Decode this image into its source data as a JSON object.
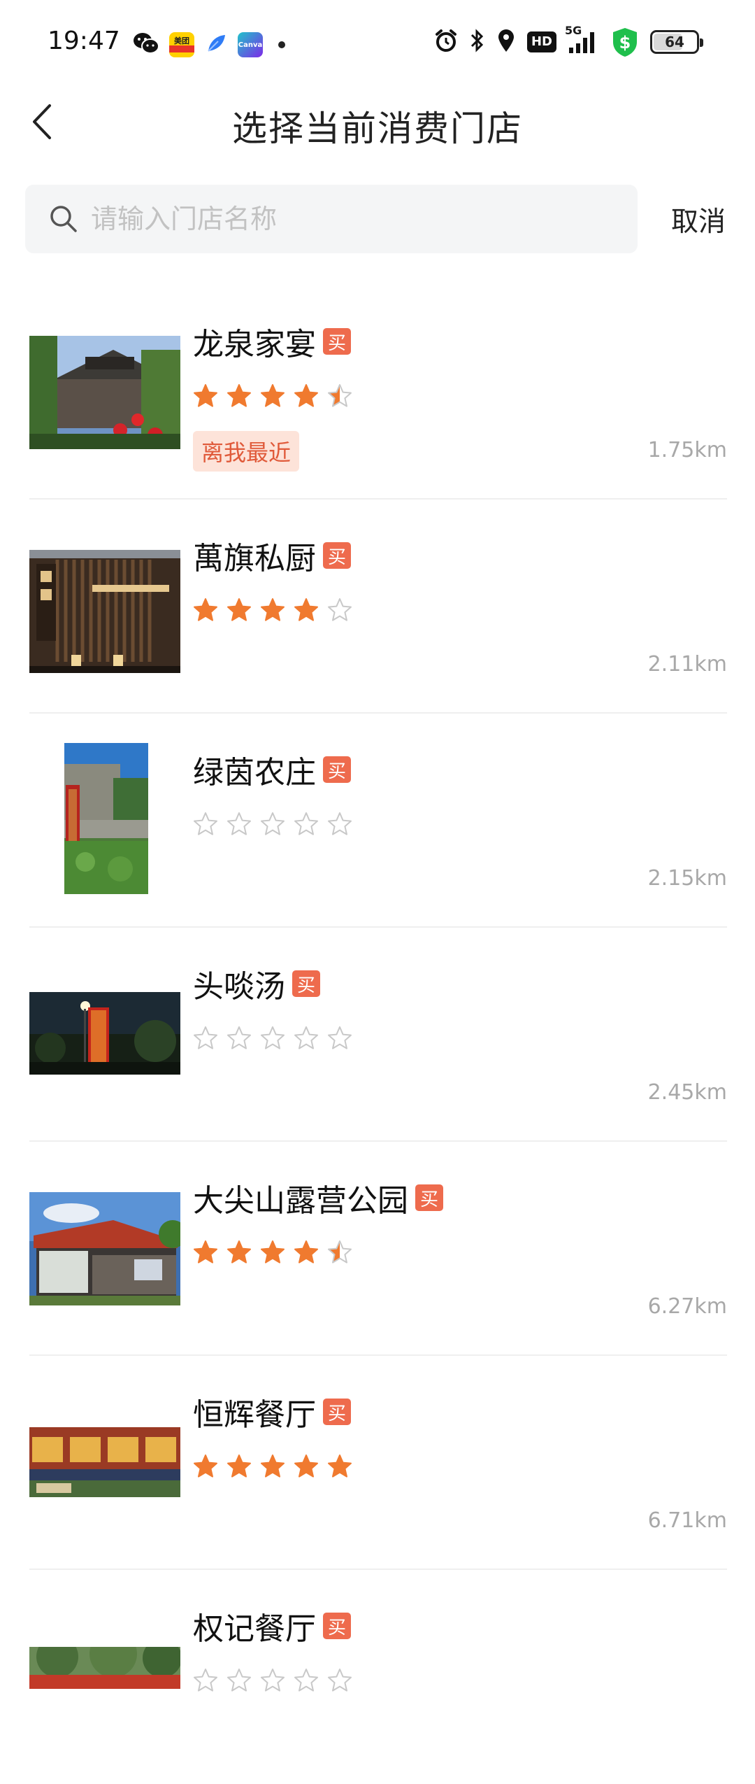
{
  "status_bar": {
    "time": "19:47",
    "meituan_label": "美团",
    "canva_label": "Canva",
    "hd_label": "HD",
    "network_label": "5G",
    "battery_level": "64"
  },
  "header": {
    "title": "选择当前消费门店"
  },
  "search": {
    "placeholder": "请输入门店名称",
    "value": "",
    "cancel_label": "取消"
  },
  "buy_tag_label": "买",
  "nearest_label": "离我最近",
  "stores": [
    {
      "name": "龙泉家宴",
      "rating": 4.5,
      "distance": "1.75km",
      "nearest": true
    },
    {
      "name": "萬旗私厨",
      "rating": 4,
      "distance": "2.11km",
      "nearest": false
    },
    {
      "name": "绿茵农庄",
      "rating": 0,
      "distance": "2.15km",
      "nearest": false
    },
    {
      "name": "头啖汤",
      "rating": 0,
      "distance": "2.45km",
      "nearest": false
    },
    {
      "name": "大尖山露营公园",
      "rating": 4.5,
      "distance": "6.27km",
      "nearest": false
    },
    {
      "name": "恒辉餐厅",
      "rating": 5,
      "distance": "6.71km",
      "nearest": false
    },
    {
      "name": "权记餐厅",
      "rating": 0,
      "distance": "",
      "nearest": false
    }
  ],
  "colors": {
    "star_filled": "#f07a2f",
    "star_empty": "#c8c8c8",
    "buy_tag": "#ee6b4d",
    "nearest_bg": "#fde3d9",
    "nearest_text": "#e05a3a"
  }
}
